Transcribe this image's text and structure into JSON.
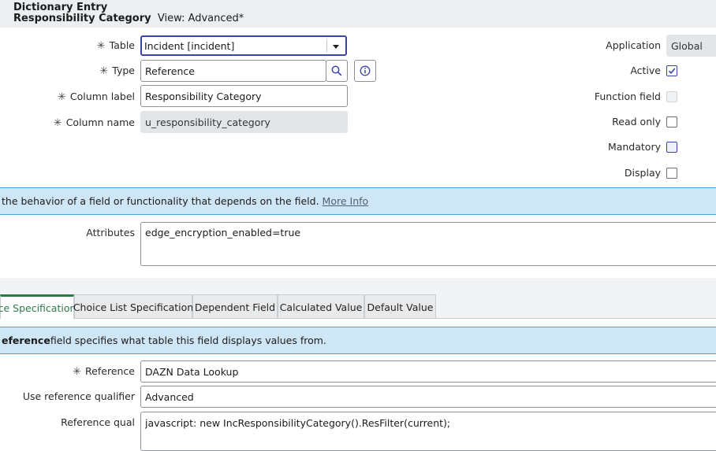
{
  "header": {
    "line1": "Dictionary Entry",
    "line2_bold": "Responsibility Category",
    "line2_view": "View: Advanced*"
  },
  "form": {
    "table": {
      "label": "Table",
      "value": "Incident [incident]"
    },
    "type": {
      "label": "Type",
      "value": "Reference"
    },
    "column_label": {
      "label": "Column label",
      "value": "Responsibility Category"
    },
    "column_name": {
      "label": "Column name",
      "value": "u_responsibility_category"
    },
    "application": {
      "label": "Application",
      "value": "Global"
    },
    "active": {
      "label": "Active",
      "checked": true
    },
    "function_field": {
      "label": "Function field",
      "checked": false
    },
    "read_only": {
      "label": "Read only",
      "checked": false
    },
    "mandatory": {
      "label": "Mandatory",
      "checked": false
    },
    "display": {
      "label": "Display",
      "checked": false
    },
    "required_marker": "✳"
  },
  "info_banner": {
    "text": "the behavior of a field or functionality that depends on the field.",
    "link": "More Info"
  },
  "attributes": {
    "label": "Attributes",
    "value": "edge_encryption_enabled=true"
  },
  "tabs": [
    {
      "label": "ce Specification",
      "active": true
    },
    {
      "label": "Choice List Specification",
      "active": false
    },
    {
      "label": "Dependent Field",
      "active": false
    },
    {
      "label": "Calculated Value",
      "active": false
    },
    {
      "label": "Default Value",
      "active": false
    }
  ],
  "reference_banner": {
    "bold": "eference",
    "text": " field specifies what table this field displays values from."
  },
  "reference_section": {
    "reference": {
      "label": "Reference",
      "value": "DAZN Data Lookup"
    },
    "use_qualifier": {
      "label": "Use reference qualifier",
      "value": "Advanced"
    },
    "qual": {
      "label": "Reference qual",
      "value": "javascript: new IncResponsibilityCategory().ResFilter(current);"
    }
  },
  "colors": {
    "accent": "#3a45a8",
    "tab_active": "#2b7a4b",
    "banner": "#cfe6f7"
  }
}
